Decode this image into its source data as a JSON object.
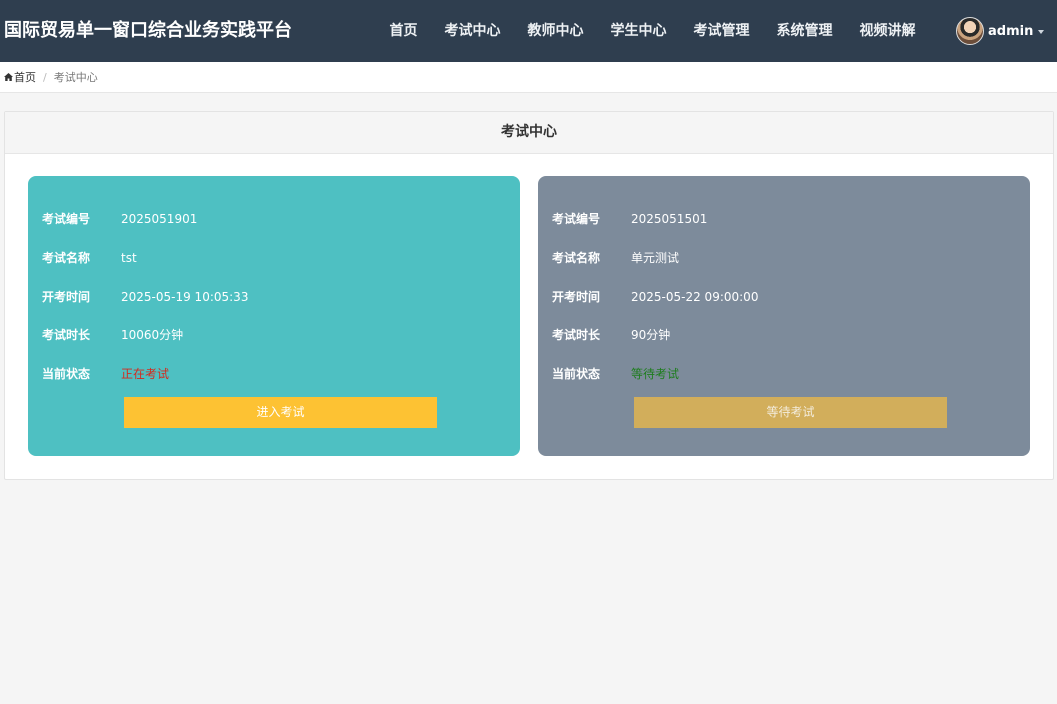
{
  "app": {
    "title": "国际贸易单一窗口综合业务实践平台"
  },
  "nav": {
    "items": [
      {
        "label": "首页"
      },
      {
        "label": "考试中心"
      },
      {
        "label": "教师中心"
      },
      {
        "label": "学生中心"
      },
      {
        "label": "考试管理"
      },
      {
        "label": "系统管理"
      },
      {
        "label": "视频讲解"
      }
    ],
    "user": {
      "name": "admin",
      "icon": "caret-down-icon"
    }
  },
  "breadcrumb": {
    "home": "首页",
    "separator": "/",
    "current": "考试中心"
  },
  "panel": {
    "title": "考试中心"
  },
  "labels": {
    "code": "考试编号",
    "name": "考试名称",
    "start": "开考时间",
    "duration": "考试时长",
    "status": "当前状态"
  },
  "exams": [
    {
      "code": "2025051901",
      "name": "tst",
      "start": "2025-05-19 10:05:33",
      "duration": "10060分钟",
      "status": "正在考试",
      "status_color": "#d42a1e",
      "button": "进入考试",
      "card_color": "#4ec0c2",
      "button_color": "#fdc233"
    },
    {
      "code": "2025051501",
      "name": "单元测试",
      "start": "2025-05-22 09:00:00",
      "duration": "90分钟",
      "status": "等待考试",
      "status_color": "#1e7d1e",
      "button": "等待考试",
      "card_color": "#7d8b9b",
      "button_color": "#d2ae5b"
    }
  ],
  "colors": {
    "navbar": "#2f3e4f",
    "page_bg": "#f5f5f5"
  }
}
